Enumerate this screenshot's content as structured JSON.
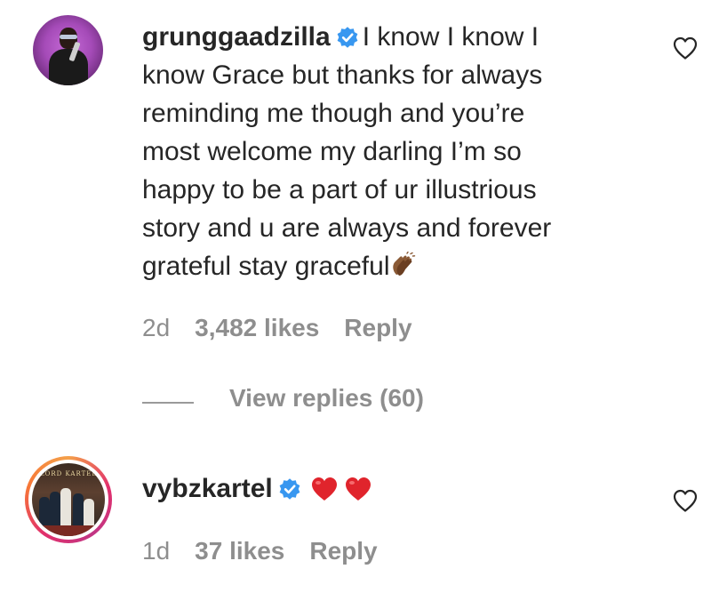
{
  "comments": [
    {
      "username": "grunggaadzilla",
      "verified": true,
      "text": "I know I know I know Grace but thanks for always reminding me though and you’re most welcome my darling I’m so happy to be a part of ur illustrious story and u are always and forever grateful stay graceful",
      "text_lines": [
        "I know I know I",
        "know Grace but thanks for always",
        "reminding me though and you’re",
        "most welcome my darling I’m so",
        "happy to be a part of ur illustrious",
        "story and u are always and forever",
        "grateful stay graceful"
      ],
      "trailing_emoji": "clapping-hands-icon",
      "age": "2d",
      "likes": "3,482 likes",
      "reply_label": "Reply",
      "view_replies_label": "View replies (60)"
    },
    {
      "username": "vybzkartel",
      "verified": true,
      "avatar_banner": "LORD KARTEL",
      "emojis": [
        "red-heart-icon",
        "red-heart-icon"
      ],
      "age": "1d",
      "likes": "37 likes",
      "reply_label": "Reply"
    }
  ],
  "colors": {
    "text": "#262626",
    "secondary": "#8e8e8e",
    "verified_blue": "#3897f0",
    "heart_red": "#e0242c"
  }
}
